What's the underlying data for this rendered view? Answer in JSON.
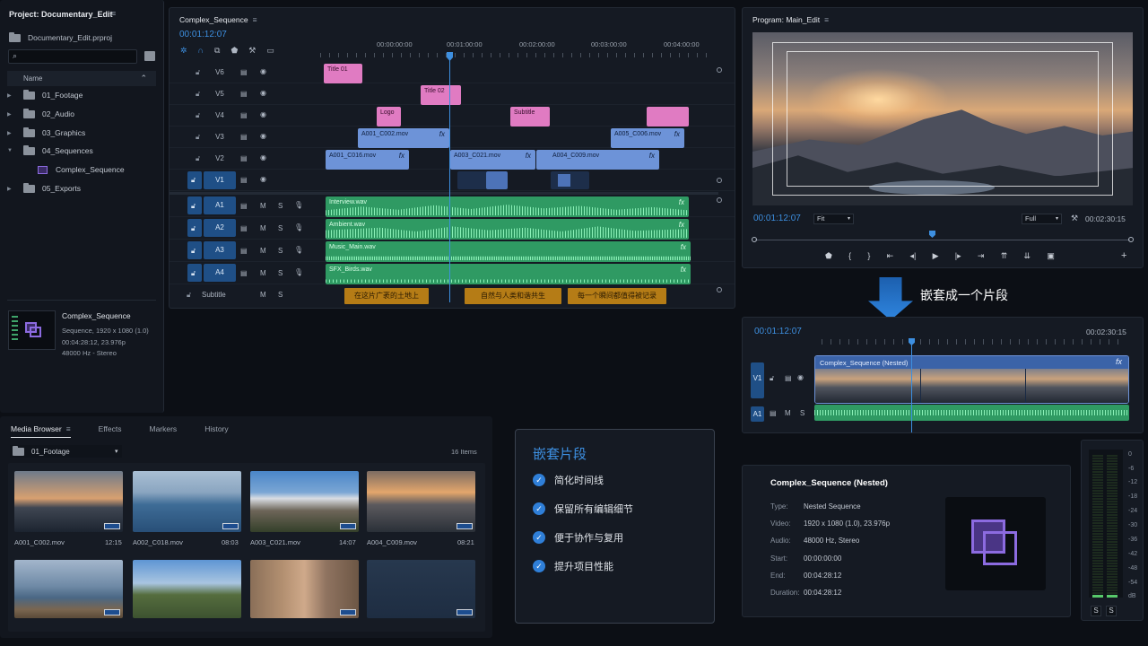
{
  "project": {
    "title": "Project: Documentary_Edit",
    "file": "Documentary_Edit.prproj",
    "column": "Name",
    "items": [
      {
        "label": "01_Footage",
        "type": "folder"
      },
      {
        "label": "02_Audio",
        "type": "folder"
      },
      {
        "label": "03_Graphics",
        "type": "folder"
      },
      {
        "label": "04_Sequences",
        "type": "folder-open"
      },
      {
        "label": "Complex_Sequence",
        "type": "sequence"
      },
      {
        "label": "05_Exports",
        "type": "folder"
      }
    ],
    "preview": {
      "name": "Complex_Sequence",
      "line1": "Sequence, 1920 x 1080 (1.0)",
      "line2": "00:04:28:12, 23.976p",
      "line3": "48000 Hz - Stereo"
    }
  },
  "timeline": {
    "title": "Complex_Sequence",
    "timecode": "00:01:12:07",
    "ruler": [
      "00:00:00:00",
      "00:01:00:00",
      "00:02:00:00",
      "00:03:00:00",
      "00:04:00:00"
    ],
    "video_tracks": [
      "V6",
      "V5",
      "V4",
      "V3",
      "V2",
      "V1"
    ],
    "audio_tracks": [
      "A1",
      "A2",
      "A3",
      "A4"
    ],
    "subtitle_track": "Subtitle",
    "m": "M",
    "s": "S",
    "clips": {
      "title01": "Title 01",
      "title02": "Title 02",
      "logo": "Logo",
      "subtitle": "Subtitle",
      "v3a": "A001_C002.mov",
      "v3b": "A005_C006.mov",
      "v2a": "A001_C016.mov",
      "v2b": "A003_C021.mov",
      "v2c": "A004_C009.mov",
      "a1": "Interview.wav",
      "a2": "Ambient.wav",
      "a3": "Music_Main.wav",
      "a4": "SFX_Birds.wav",
      "fx": "fx"
    },
    "subs": [
      "在这片广袤的土地上",
      "自然与人类和谐共生",
      "每一个瞬间都值得被记录"
    ]
  },
  "program": {
    "title": "Program: Main_Edit",
    "timecode": "00:01:12:07",
    "fit": "Fit",
    "quality": "Full",
    "duration": "00:02:30:15"
  },
  "arrow_label": "嵌套成一个片段",
  "nested_timeline": {
    "timecode": "00:01:12:07",
    "duration": "00:02:30:15",
    "v1": "V1",
    "a1": "A1",
    "m": "M",
    "s": "S",
    "clip": "Complex_Sequence (Nested)",
    "fx": "fx"
  },
  "media_browser": {
    "tabs": [
      "Media Browser",
      "Effects",
      "Markers",
      "History"
    ],
    "folder": "01_Footage",
    "count": "16 Items",
    "items": [
      {
        "name": "A001_C002.mov",
        "dur": "12:15"
      },
      {
        "name": "A002_C018.mov",
        "dur": "08:03"
      },
      {
        "name": "A003_C021.mov",
        "dur": "14:07"
      },
      {
        "name": "A004_C009.mov",
        "dur": "08:21"
      }
    ]
  },
  "features": {
    "title": "嵌套片段",
    "items": [
      "简化时间线",
      "保留所有编辑细节",
      "便于协作与复用",
      "提升项目性能"
    ]
  },
  "info": {
    "title": "Complex_Sequence (Nested)",
    "rows": [
      {
        "k": "Type:",
        "v": "Nested Sequence"
      },
      {
        "k": "Video:",
        "v": "1920 x 1080 (1.0), 23.976p"
      },
      {
        "k": "Audio:",
        "v": "48000 Hz, Stereo"
      },
      {
        "k": "Start:",
        "v": "00:00:00:00"
      },
      {
        "k": "End:",
        "v": "00:04:28:12"
      },
      {
        "k": "Duration:",
        "v": "00:04:28:12"
      }
    ]
  },
  "meter": {
    "ticks": [
      "0",
      "-6",
      "-12",
      "-18",
      "-24",
      "-30",
      "-36",
      "-42",
      "-48",
      "-54",
      "dB"
    ],
    "solo": [
      "S",
      "S"
    ]
  }
}
